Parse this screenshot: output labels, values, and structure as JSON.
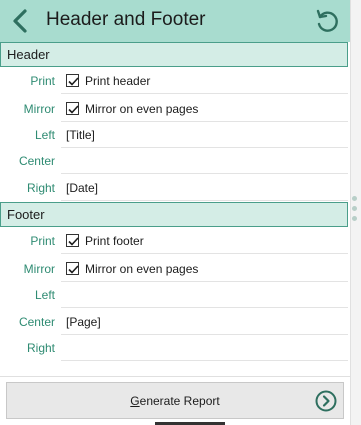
{
  "titlebar": {
    "title": "Header and Footer",
    "back_icon": "chevron-left-icon",
    "reset_icon": "reset-icon"
  },
  "colors": {
    "titlebar_bg": "#a8dccf",
    "section_bg": "#d4ede6",
    "accent": "#2e8b72"
  },
  "header_section": {
    "title": "Header",
    "print": {
      "label": "Print",
      "checked": true,
      "checkbox_label": "Print header"
    },
    "mirror": {
      "label": "Mirror",
      "checked": true,
      "checkbox_label": "Mirror on even pages"
    },
    "left": {
      "label": "Left",
      "value": "[Title]"
    },
    "center": {
      "label": "Center",
      "value": ""
    },
    "right": {
      "label": "Right",
      "value": "[Date]"
    }
  },
  "footer_section": {
    "title": "Footer",
    "print": {
      "label": "Print",
      "checked": true,
      "checkbox_label": "Print footer"
    },
    "mirror": {
      "label": "Mirror",
      "checked": true,
      "checkbox_label": "Mirror on even pages"
    },
    "left": {
      "label": "Left",
      "value": ""
    },
    "center": {
      "label": "Center",
      "value": "[Page]"
    },
    "right": {
      "label": "Right",
      "value": ""
    }
  },
  "generate_button": {
    "accesskey": "G",
    "label_rest": "enerate Report",
    "icon": "circle-chevron-right-icon"
  }
}
